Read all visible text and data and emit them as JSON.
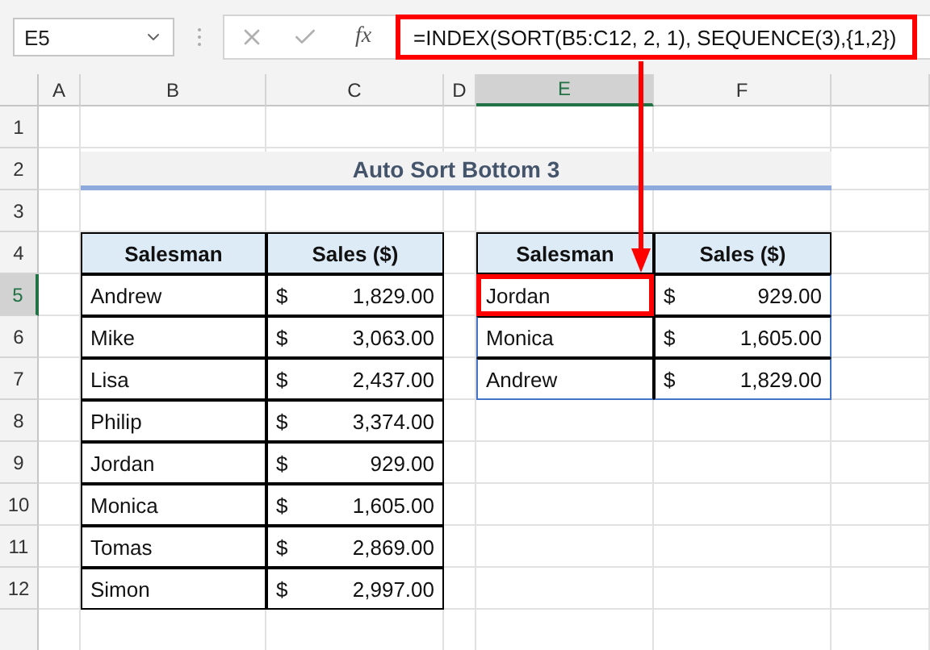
{
  "name_box": {
    "value": "E5"
  },
  "formula_bar": {
    "function_label": "fx",
    "formula": "=INDEX(SORT(B5:C12, 2, 1), SEQUENCE(3),{1,2})"
  },
  "columns": [
    {
      "label": "A",
      "selected": false
    },
    {
      "label": "B",
      "selected": false
    },
    {
      "label": "C",
      "selected": false
    },
    {
      "label": "D",
      "selected": false
    },
    {
      "label": "E",
      "selected": true
    },
    {
      "label": "F",
      "selected": false
    }
  ],
  "rows": [
    {
      "label": "1",
      "selected": false
    },
    {
      "label": "2",
      "selected": false
    },
    {
      "label": "3",
      "selected": false
    },
    {
      "label": "4",
      "selected": false
    },
    {
      "label": "5",
      "selected": true
    },
    {
      "label": "6",
      "selected": false
    },
    {
      "label": "7",
      "selected": false
    },
    {
      "label": "8",
      "selected": false
    },
    {
      "label": "9",
      "selected": false
    },
    {
      "label": "10",
      "selected": false
    },
    {
      "label": "11",
      "selected": false
    },
    {
      "label": "12",
      "selected": false
    }
  ],
  "title": "Auto Sort Bottom 3",
  "source_table": {
    "columns": [
      "Salesman",
      "Sales ($)"
    ],
    "rows": [
      {
        "name": "Andrew",
        "currency": "$",
        "amount": "1,829.00"
      },
      {
        "name": "Mike",
        "currency": "$",
        "amount": "3,063.00"
      },
      {
        "name": "Lisa",
        "currency": "$",
        "amount": "2,437.00"
      },
      {
        "name": "Philip",
        "currency": "$",
        "amount": "3,374.00"
      },
      {
        "name": "Jordan",
        "currency": "$",
        "amount": "929.00"
      },
      {
        "name": "Monica",
        "currency": "$",
        "amount": "1,605.00"
      },
      {
        "name": "Tomas",
        "currency": "$",
        "amount": "2,869.00"
      },
      {
        "name": "Simon",
        "currency": "$",
        "amount": "2,997.00"
      }
    ]
  },
  "result_table": {
    "columns": [
      "Salesman",
      "Sales ($)"
    ],
    "rows": [
      {
        "name": "Jordan",
        "currency": "$",
        "amount": "929.00",
        "selected": true
      },
      {
        "name": "Monica",
        "currency": "$",
        "amount": "1,605.00",
        "selected": false
      },
      {
        "name": "Andrew",
        "currency": "$",
        "amount": "1,829.00",
        "selected": false
      }
    ]
  }
}
